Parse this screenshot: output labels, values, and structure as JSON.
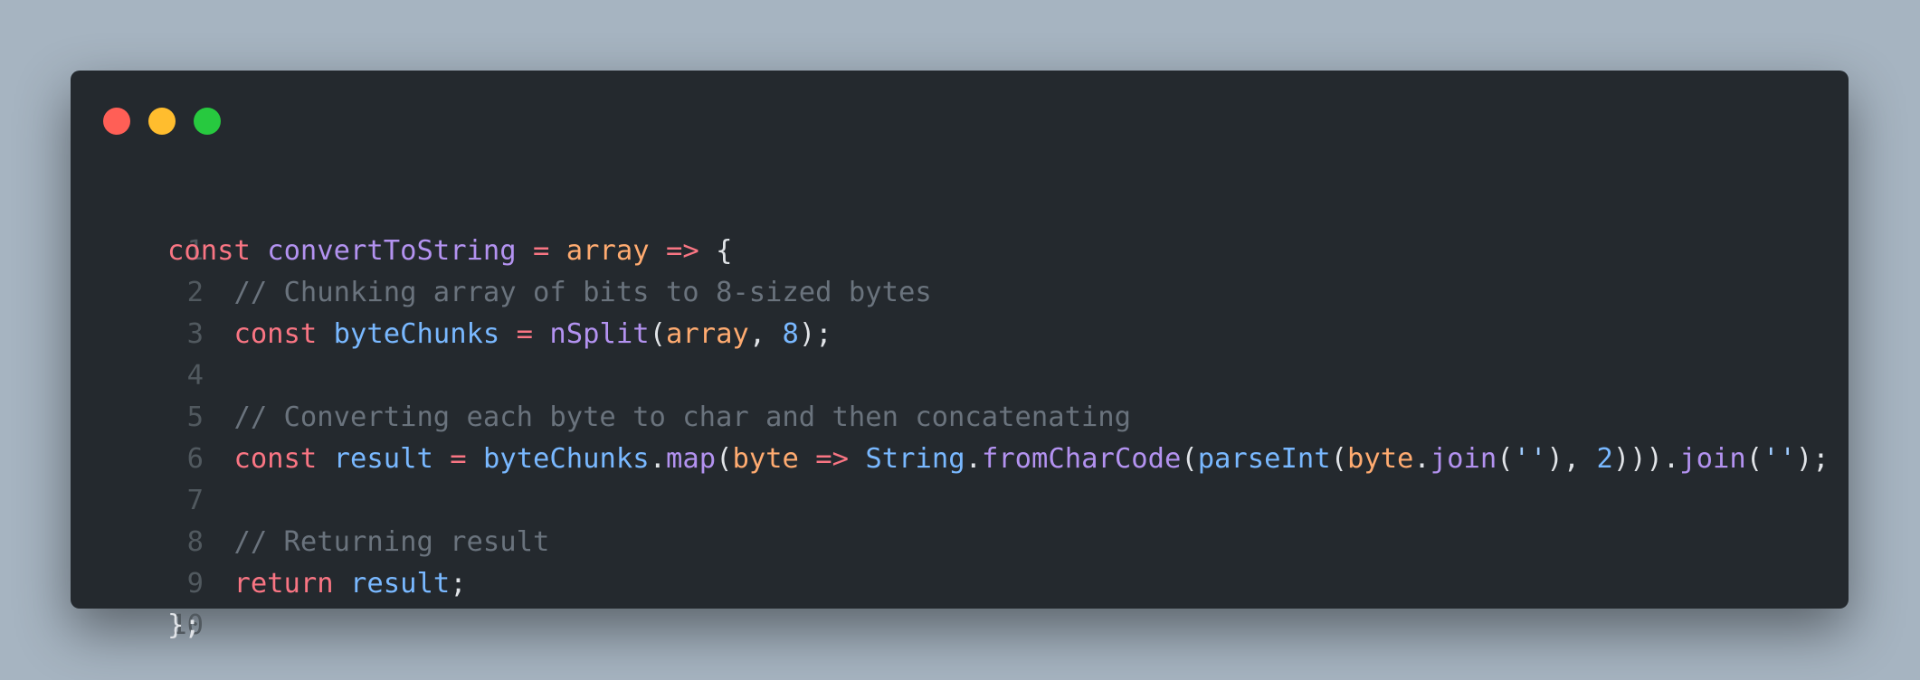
{
  "window": {
    "controls": [
      "close",
      "minimize",
      "maximize"
    ],
    "colors": {
      "background": "#24292e",
      "close": "#ff5f56",
      "minimize": "#ffbd2e",
      "maximize": "#27c93f"
    }
  },
  "code": {
    "language": "javascript",
    "line_numbers": [
      "1",
      "2",
      "3",
      "4",
      "5",
      "6",
      "7",
      "8",
      "9",
      "10"
    ],
    "lines": [
      [
        {
          "t": "const",
          "c": "kw"
        },
        {
          "t": " ",
          "c": "pl"
        },
        {
          "t": "convertToString",
          "c": "fn"
        },
        {
          "t": " ",
          "c": "pl"
        },
        {
          "t": "=",
          "c": "op"
        },
        {
          "t": " ",
          "c": "pl"
        },
        {
          "t": "array",
          "c": "prm"
        },
        {
          "t": " ",
          "c": "pl"
        },
        {
          "t": "=>",
          "c": "op"
        },
        {
          "t": " {",
          "c": "pl"
        }
      ],
      [
        {
          "t": "    ",
          "c": "pl"
        },
        {
          "t": "// Chunking array of bits to 8-sized bytes",
          "c": "cmt"
        }
      ],
      [
        {
          "t": "    ",
          "c": "pl"
        },
        {
          "t": "const",
          "c": "kw"
        },
        {
          "t": " ",
          "c": "pl"
        },
        {
          "t": "byteChunks",
          "c": "id"
        },
        {
          "t": " ",
          "c": "pl"
        },
        {
          "t": "=",
          "c": "op"
        },
        {
          "t": " ",
          "c": "pl"
        },
        {
          "t": "nSplit",
          "c": "fn"
        },
        {
          "t": "(",
          "c": "pl"
        },
        {
          "t": "array",
          "c": "prm"
        },
        {
          "t": ", ",
          "c": "pl"
        },
        {
          "t": "8",
          "c": "num"
        },
        {
          "t": ");",
          "c": "pl"
        }
      ],
      [],
      [
        {
          "t": "    ",
          "c": "pl"
        },
        {
          "t": "// Converting each byte to char and then concatenating",
          "c": "cmt"
        }
      ],
      [
        {
          "t": "    ",
          "c": "pl"
        },
        {
          "t": "const",
          "c": "kw"
        },
        {
          "t": " ",
          "c": "pl"
        },
        {
          "t": "result",
          "c": "id"
        },
        {
          "t": " ",
          "c": "pl"
        },
        {
          "t": "=",
          "c": "op"
        },
        {
          "t": " ",
          "c": "pl"
        },
        {
          "t": "byteChunks",
          "c": "id"
        },
        {
          "t": ".",
          "c": "pl"
        },
        {
          "t": "map",
          "c": "fn"
        },
        {
          "t": "(",
          "c": "pl"
        },
        {
          "t": "byte",
          "c": "prm"
        },
        {
          "t": " ",
          "c": "pl"
        },
        {
          "t": "=>",
          "c": "op"
        },
        {
          "t": " ",
          "c": "pl"
        },
        {
          "t": "String",
          "c": "id"
        },
        {
          "t": ".",
          "c": "pl"
        },
        {
          "t": "fromCharCode",
          "c": "fn"
        },
        {
          "t": "(",
          "c": "pl"
        },
        {
          "t": "parseInt",
          "c": "id"
        },
        {
          "t": "(",
          "c": "pl"
        },
        {
          "t": "byte",
          "c": "prm"
        },
        {
          "t": ".",
          "c": "pl"
        },
        {
          "t": "join",
          "c": "fn"
        },
        {
          "t": "(",
          "c": "pl"
        },
        {
          "t": "''",
          "c": "str"
        },
        {
          "t": "), ",
          "c": "pl"
        },
        {
          "t": "2",
          "c": "num"
        },
        {
          "t": "))).",
          "c": "pl"
        },
        {
          "t": "join",
          "c": "fn"
        },
        {
          "t": "(",
          "c": "pl"
        },
        {
          "t": "''",
          "c": "str"
        },
        {
          "t": ");",
          "c": "pl"
        }
      ],
      [],
      [
        {
          "t": "    ",
          "c": "pl"
        },
        {
          "t": "// Returning result",
          "c": "cmt"
        }
      ],
      [
        {
          "t": "    ",
          "c": "pl"
        },
        {
          "t": "return",
          "c": "kw"
        },
        {
          "t": " ",
          "c": "pl"
        },
        {
          "t": "result",
          "c": "id"
        },
        {
          "t": ";",
          "c": "pl"
        }
      ],
      [
        {
          "t": "};",
          "c": "pl"
        }
      ]
    ]
  }
}
